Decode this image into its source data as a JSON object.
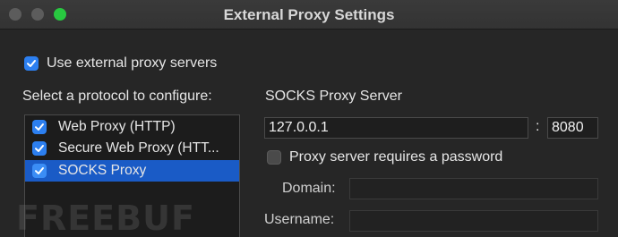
{
  "window": {
    "title": "External Proxy Settings"
  },
  "use_external": {
    "label": "Use external proxy servers",
    "checked": true
  },
  "protocols": {
    "heading": "Select a protocol to configure:",
    "items": [
      {
        "label": "Web Proxy (HTTP)",
        "checked": true,
        "selected": false
      },
      {
        "label": "Secure Web Proxy (HTT...",
        "checked": true,
        "selected": false
      },
      {
        "label": "SOCKS Proxy",
        "checked": true,
        "selected": true
      }
    ]
  },
  "server": {
    "heading": "SOCKS Proxy Server",
    "host": "127.0.0.1",
    "separator": ":",
    "port": "8080",
    "requires_password_label": "Proxy server requires a password",
    "requires_password": false,
    "domain_label": "Domain:",
    "domain_value": "",
    "username_label": "Username:",
    "username_value": ""
  },
  "watermark": "FREEBUF",
  "colors": {
    "accent": "#2c7ff0",
    "selection": "#1a5bc6",
    "background": "#262626"
  }
}
